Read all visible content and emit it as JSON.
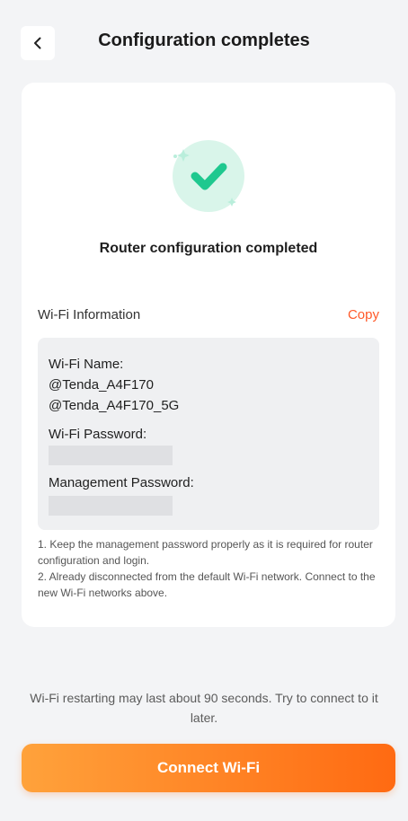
{
  "header": {
    "title": "Configuration completes",
    "back_icon": "chevron-left-icon"
  },
  "success": {
    "icon": "check-circle-icon",
    "title": "Router configuration completed",
    "accent_color": "#1fc88f"
  },
  "wifi_info": {
    "label": "Wi-Fi Information",
    "copy_label": "Copy",
    "wifi_name_label": "Wi-Fi Name:",
    "wifi_names": [
      "@Tenda_A4F170",
      "@Tenda_A4F170_5G"
    ],
    "wifi_password_label": "Wi-Fi Password:",
    "management_password_label": "Management Password:"
  },
  "notes": {
    "line1": "1. Keep the management password properly as it is required for router configuration and login.",
    "line2": "2. Already disconnected from the default Wi-Fi network. Connect to the new Wi-Fi networks above."
  },
  "footer": {
    "restart_note": "Wi-Fi restarting may last about 90 seconds. Try to connect to it later.",
    "connect_button": "Connect Wi-Fi"
  },
  "colors": {
    "accent": "#ff5a2a",
    "button_gradient_start": "#ffa23b",
    "button_gradient_end": "#ff6a12"
  }
}
